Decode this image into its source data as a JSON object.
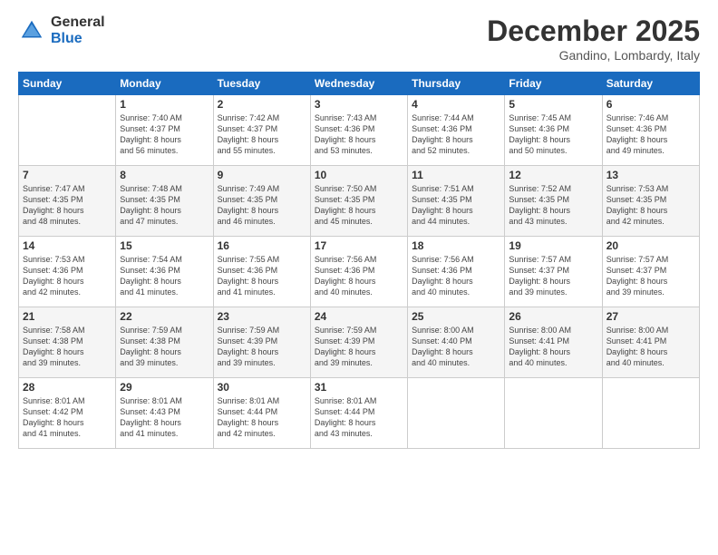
{
  "logo": {
    "general": "General",
    "blue": "Blue"
  },
  "header": {
    "month": "December 2025",
    "location": "Gandino, Lombardy, Italy"
  },
  "days_header": [
    "Sunday",
    "Monday",
    "Tuesday",
    "Wednesday",
    "Thursday",
    "Friday",
    "Saturday"
  ],
  "weeks": [
    [
      {
        "day": "",
        "info": ""
      },
      {
        "day": "1",
        "info": "Sunrise: 7:40 AM\nSunset: 4:37 PM\nDaylight: 8 hours\nand 56 minutes."
      },
      {
        "day": "2",
        "info": "Sunrise: 7:42 AM\nSunset: 4:37 PM\nDaylight: 8 hours\nand 55 minutes."
      },
      {
        "day": "3",
        "info": "Sunrise: 7:43 AM\nSunset: 4:36 PM\nDaylight: 8 hours\nand 53 minutes."
      },
      {
        "day": "4",
        "info": "Sunrise: 7:44 AM\nSunset: 4:36 PM\nDaylight: 8 hours\nand 52 minutes."
      },
      {
        "day": "5",
        "info": "Sunrise: 7:45 AM\nSunset: 4:36 PM\nDaylight: 8 hours\nand 50 minutes."
      },
      {
        "day": "6",
        "info": "Sunrise: 7:46 AM\nSunset: 4:36 PM\nDaylight: 8 hours\nand 49 minutes."
      }
    ],
    [
      {
        "day": "7",
        "info": "Sunrise: 7:47 AM\nSunset: 4:35 PM\nDaylight: 8 hours\nand 48 minutes."
      },
      {
        "day": "8",
        "info": "Sunrise: 7:48 AM\nSunset: 4:35 PM\nDaylight: 8 hours\nand 47 minutes."
      },
      {
        "day": "9",
        "info": "Sunrise: 7:49 AM\nSunset: 4:35 PM\nDaylight: 8 hours\nand 46 minutes."
      },
      {
        "day": "10",
        "info": "Sunrise: 7:50 AM\nSunset: 4:35 PM\nDaylight: 8 hours\nand 45 minutes."
      },
      {
        "day": "11",
        "info": "Sunrise: 7:51 AM\nSunset: 4:35 PM\nDaylight: 8 hours\nand 44 minutes."
      },
      {
        "day": "12",
        "info": "Sunrise: 7:52 AM\nSunset: 4:35 PM\nDaylight: 8 hours\nand 43 minutes."
      },
      {
        "day": "13",
        "info": "Sunrise: 7:53 AM\nSunset: 4:35 PM\nDaylight: 8 hours\nand 42 minutes."
      }
    ],
    [
      {
        "day": "14",
        "info": "Sunrise: 7:53 AM\nSunset: 4:36 PM\nDaylight: 8 hours\nand 42 minutes."
      },
      {
        "day": "15",
        "info": "Sunrise: 7:54 AM\nSunset: 4:36 PM\nDaylight: 8 hours\nand 41 minutes."
      },
      {
        "day": "16",
        "info": "Sunrise: 7:55 AM\nSunset: 4:36 PM\nDaylight: 8 hours\nand 41 minutes."
      },
      {
        "day": "17",
        "info": "Sunrise: 7:56 AM\nSunset: 4:36 PM\nDaylight: 8 hours\nand 40 minutes."
      },
      {
        "day": "18",
        "info": "Sunrise: 7:56 AM\nSunset: 4:36 PM\nDaylight: 8 hours\nand 40 minutes."
      },
      {
        "day": "19",
        "info": "Sunrise: 7:57 AM\nSunset: 4:37 PM\nDaylight: 8 hours\nand 39 minutes."
      },
      {
        "day": "20",
        "info": "Sunrise: 7:57 AM\nSunset: 4:37 PM\nDaylight: 8 hours\nand 39 minutes."
      }
    ],
    [
      {
        "day": "21",
        "info": "Sunrise: 7:58 AM\nSunset: 4:38 PM\nDaylight: 8 hours\nand 39 minutes."
      },
      {
        "day": "22",
        "info": "Sunrise: 7:59 AM\nSunset: 4:38 PM\nDaylight: 8 hours\nand 39 minutes."
      },
      {
        "day": "23",
        "info": "Sunrise: 7:59 AM\nSunset: 4:39 PM\nDaylight: 8 hours\nand 39 minutes."
      },
      {
        "day": "24",
        "info": "Sunrise: 7:59 AM\nSunset: 4:39 PM\nDaylight: 8 hours\nand 39 minutes."
      },
      {
        "day": "25",
        "info": "Sunrise: 8:00 AM\nSunset: 4:40 PM\nDaylight: 8 hours\nand 40 minutes."
      },
      {
        "day": "26",
        "info": "Sunrise: 8:00 AM\nSunset: 4:41 PM\nDaylight: 8 hours\nand 40 minutes."
      },
      {
        "day": "27",
        "info": "Sunrise: 8:00 AM\nSunset: 4:41 PM\nDaylight: 8 hours\nand 40 minutes."
      }
    ],
    [
      {
        "day": "28",
        "info": "Sunrise: 8:01 AM\nSunset: 4:42 PM\nDaylight: 8 hours\nand 41 minutes."
      },
      {
        "day": "29",
        "info": "Sunrise: 8:01 AM\nSunset: 4:43 PM\nDaylight: 8 hours\nand 41 minutes."
      },
      {
        "day": "30",
        "info": "Sunrise: 8:01 AM\nSunset: 4:44 PM\nDaylight: 8 hours\nand 42 minutes."
      },
      {
        "day": "31",
        "info": "Sunrise: 8:01 AM\nSunset: 4:44 PM\nDaylight: 8 hours\nand 43 minutes."
      },
      {
        "day": "",
        "info": ""
      },
      {
        "day": "",
        "info": ""
      },
      {
        "day": "",
        "info": ""
      }
    ]
  ]
}
